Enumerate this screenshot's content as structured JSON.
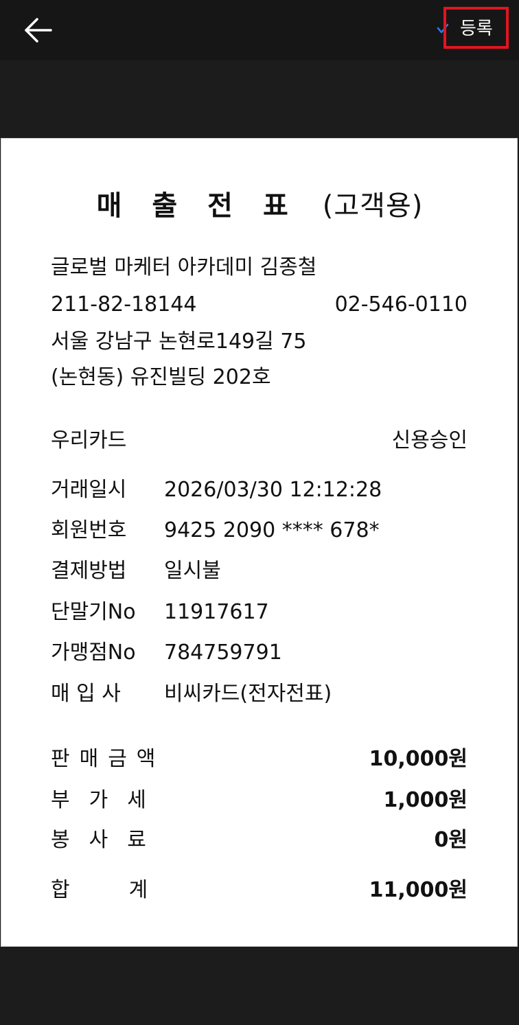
{
  "header": {
    "back_icon": "arrow-left-icon",
    "check_icon": "check-icon",
    "register_label": "등록",
    "accent_color": "#2f7bf6",
    "highlight_color": "#e3141f"
  },
  "receipt": {
    "title_main": "매출전표",
    "title_sub": "(고객용)",
    "merchant_name": "글로벌 마케터 아카데미 김종철",
    "business_number": "211-82-18144",
    "phone": "02-546-0110",
    "address_line1": "서울 강남구 논현로149길 75",
    "address_line2": "(논현동) 유진빌딩 202호",
    "card_company": "우리카드",
    "approval_type": "신용승인",
    "details": [
      {
        "label": "거래일시",
        "value": "2026/03/30 12:12:28"
      },
      {
        "label": "회원번호",
        "value": "9425 2090 **** 678*"
      },
      {
        "label": "결제방법",
        "value": "일시불"
      },
      {
        "label": "단말기No",
        "value": "11917617"
      },
      {
        "label": "가맹점No",
        "value": "784759791"
      },
      {
        "label": "매 입 사",
        "value": "비씨카드(전자전표)"
      }
    ],
    "amounts": [
      {
        "label": "판매금액",
        "value": "10,000원"
      },
      {
        "label": "부가세",
        "value": "1,000원"
      },
      {
        "label": "봉사료",
        "value": "0원"
      },
      {
        "label": "합계",
        "value": "11,000원"
      }
    ]
  }
}
